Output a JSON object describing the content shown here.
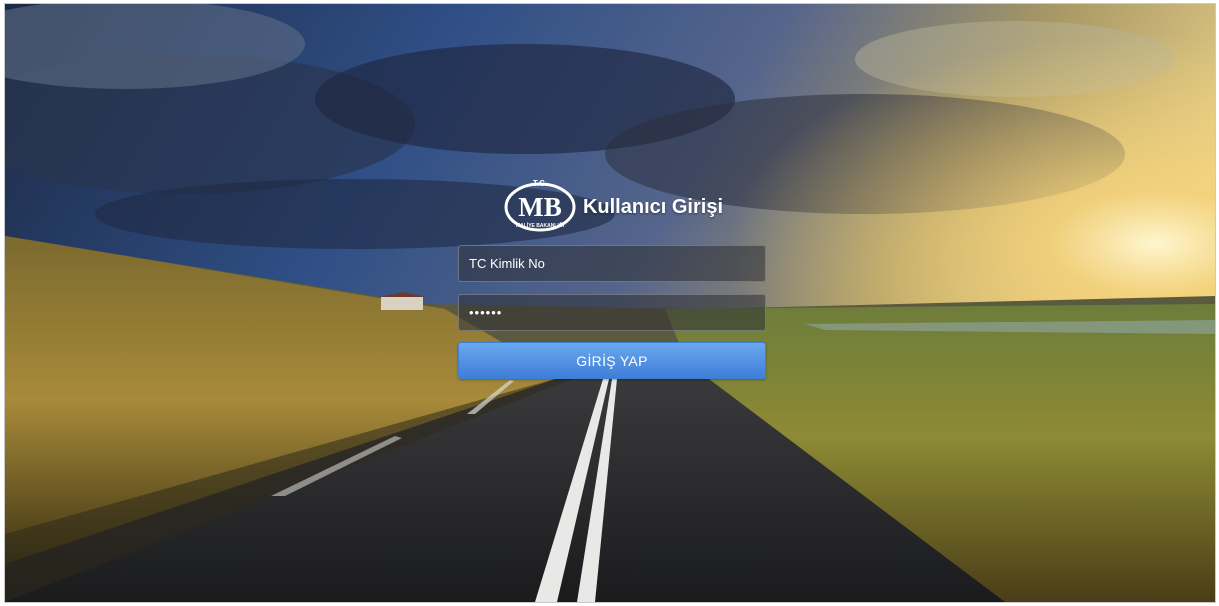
{
  "brand": {
    "logo_top": "T.C.",
    "logo_mark": "MB",
    "logo_ring": "MALİYE BAKANLIĞI",
    "title": "Kullanıcı Girişi"
  },
  "form": {
    "username_placeholder": "TC Kimlik No",
    "password_value": "••••••",
    "submit_label": "GİRİŞ YAP"
  },
  "colors": {
    "button": "#4f8fe0",
    "field_bg": "#2d3034"
  }
}
